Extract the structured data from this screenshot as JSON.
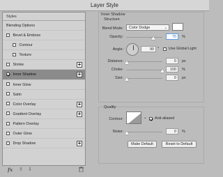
{
  "window": {
    "title": "Layer Style"
  },
  "left_panel": {
    "header": "Styles",
    "items": [
      {
        "label": "Blending Options",
        "type": "header"
      },
      {
        "label": "Bevel & Emboss",
        "checked": false
      },
      {
        "label": "Contour",
        "checked": false,
        "indent": true
      },
      {
        "label": "Texture",
        "checked": false,
        "indent": true
      },
      {
        "label": "Stroke",
        "checked": false,
        "plus": true
      },
      {
        "label": "Inner Shadow",
        "checked": true,
        "plus": true,
        "selected": true
      },
      {
        "label": "Inner Glow",
        "checked": false
      },
      {
        "label": "Satin",
        "checked": false
      },
      {
        "label": "Color Overlay",
        "checked": false,
        "plus": true
      },
      {
        "label": "Gradient Overlay",
        "checked": false,
        "plus": true
      },
      {
        "label": "Pattern Overlay",
        "checked": false
      },
      {
        "label": "Outer Glow",
        "checked": false
      },
      {
        "label": "Drop Shadow",
        "checked": false,
        "plus": true
      }
    ],
    "bottom_icons": [
      "fx-icon",
      "arrow-up-icon",
      "arrow-down-icon",
      "trash-icon"
    ]
  },
  "inner_shadow": {
    "group_title": "Inner Shadow",
    "subgroup_title": "Structure",
    "blend_mode_label": "Blend Mode:",
    "blend_mode_value": "Color Dodge",
    "swatch_color": "#ffffff",
    "opacity_label": "Opacity:",
    "opacity_value": "75",
    "opacity_unit": "%",
    "angle_label": "Angle:",
    "angle_value": "90",
    "angle_unit": "°",
    "global_light_label": "Use Global Light",
    "global_light_checked": false,
    "distance_label": "Distance:",
    "distance_value": "0",
    "distance_unit": "px",
    "choke_label": "Choke:",
    "choke_value": "100",
    "choke_unit": "%",
    "size_label": "Size:",
    "size_value": "0",
    "size_unit": "px"
  },
  "quality": {
    "title": "Quality",
    "contour_label": "Contour:",
    "anti_aliased_label": "Anti-aliased",
    "anti_aliased_checked": true,
    "noise_label": "Noise:",
    "noise_value": "0",
    "noise_unit": "%"
  },
  "buttons": {
    "make_default": "Make Default",
    "reset_to_default": "Reset to Default"
  }
}
